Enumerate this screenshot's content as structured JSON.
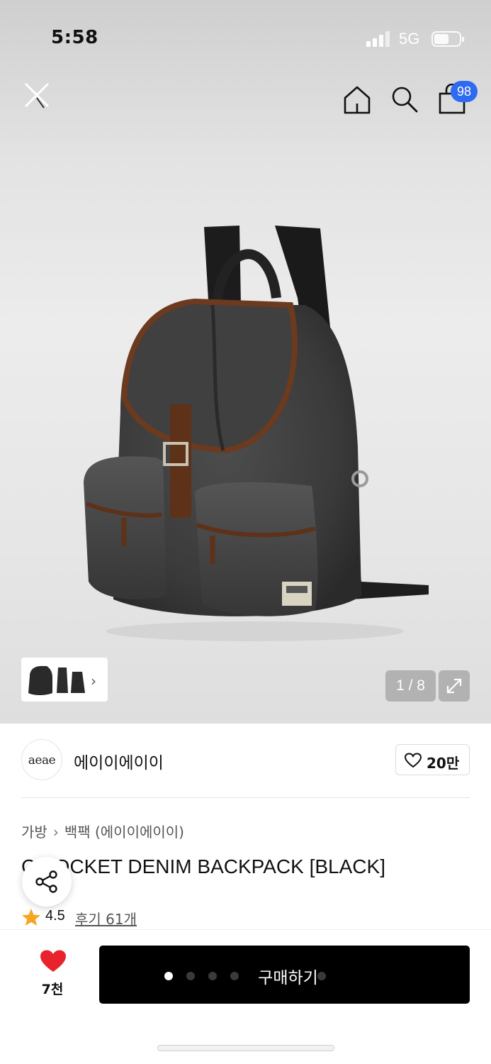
{
  "status_bar": {
    "time": "5:58",
    "network": "5G"
  },
  "header": {
    "cart_count": "98",
    "icons": [
      "close-icon",
      "home-icon",
      "search-icon",
      "cart-icon"
    ]
  },
  "gallery": {
    "counter": "1 / 8",
    "current_image": 1,
    "total_images": 8
  },
  "brand": {
    "logo_text": "aeae",
    "name": "에이이에이이",
    "like_count": "20만"
  },
  "breadcrumb": {
    "items": [
      "가방",
      "백팩 (에이이에이이)"
    ]
  },
  "product": {
    "title": "C    POCKET DENIM BACKPACK [BLACK]",
    "rating": "4.5",
    "review_label": "후기 61개"
  },
  "bottom_bar": {
    "wish_count": "7천",
    "buy_label": "구매하기",
    "carousel_dots": 5,
    "active_dot": 0
  },
  "colors": {
    "accent": "#2f6bf0",
    "heart": "#e8232b",
    "star": "#f5a623",
    "buy_button": "#000000"
  }
}
